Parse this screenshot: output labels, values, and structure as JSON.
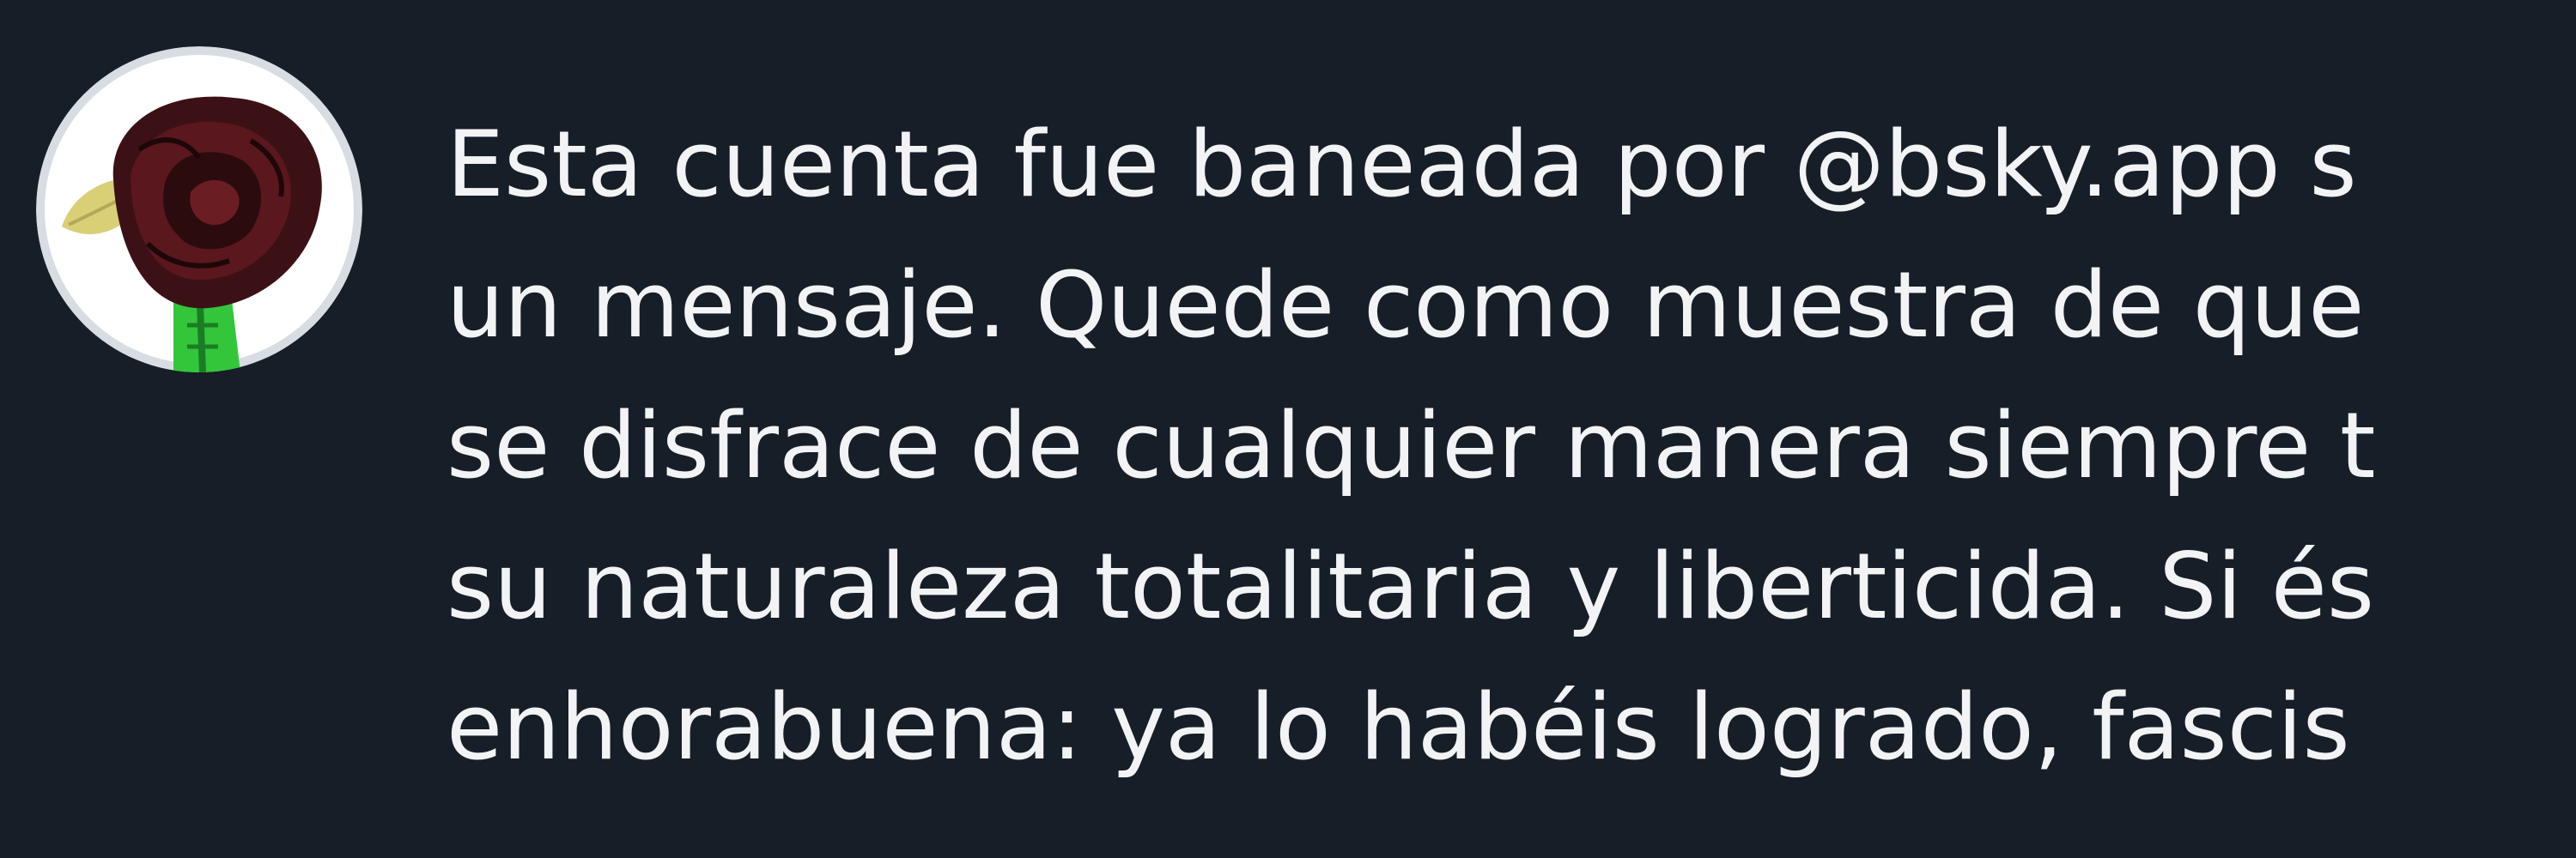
{
  "post": {
    "avatar_icon": "rose-avatar-icon",
    "lines": [
      "Esta cuenta fue baneada por @bsky.app s",
      "un mensaje. Quede como muestra de que",
      "se disfrace de cualquier manera siempre t",
      "su naturaleza totalitaria y liberticida. Si és",
      "enhorabuena: ya lo habéis logrado, fascis"
    ]
  },
  "colors": {
    "background": "#161e27",
    "text": "#f2f3f5",
    "avatar_background": "#ffffff",
    "rose": "#4a1418",
    "stem": "#38c93a"
  }
}
